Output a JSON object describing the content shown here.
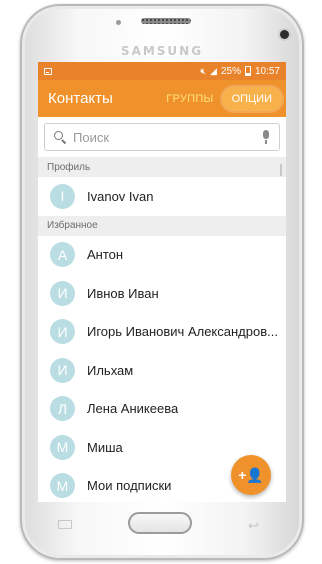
{
  "device": {
    "brand": "SAMSUNG"
  },
  "status_bar": {
    "battery": "25%",
    "time": "10:57",
    "icons": [
      "notification-icon",
      "mute-icon",
      "signal-icon",
      "battery-icon"
    ]
  },
  "app_bar": {
    "title": "Контакты",
    "groups": "ГРУППЫ",
    "options": "ОПЦИИ"
  },
  "search": {
    "placeholder": "Поиск"
  },
  "sections": {
    "profile": {
      "title": "Профиль",
      "contact": {
        "initial": "I",
        "name": "Ivanov Ivan"
      }
    },
    "favorites": {
      "title": "Избранное",
      "contacts": [
        {
          "initial": "А",
          "name": "Антон"
        },
        {
          "initial": "И",
          "name": "Ивнов Иван"
        },
        {
          "initial": "И",
          "name": "Игорь Иванович Александров..."
        },
        {
          "initial": "И",
          "name": "Ильхам"
        },
        {
          "initial": "Л",
          "name": "Лена Аникеева"
        },
        {
          "initial": "М",
          "name": "Миша"
        },
        {
          "initial": "М",
          "name": "Мои подписки"
        }
      ]
    }
  },
  "fab": {
    "icon": "add-contact-icon",
    "label": "+👤"
  },
  "colors": {
    "accent": "#f0922c",
    "statusbar": "#e8822b",
    "avatar": "#b9dde2",
    "groups_text": "#ffe27a"
  }
}
